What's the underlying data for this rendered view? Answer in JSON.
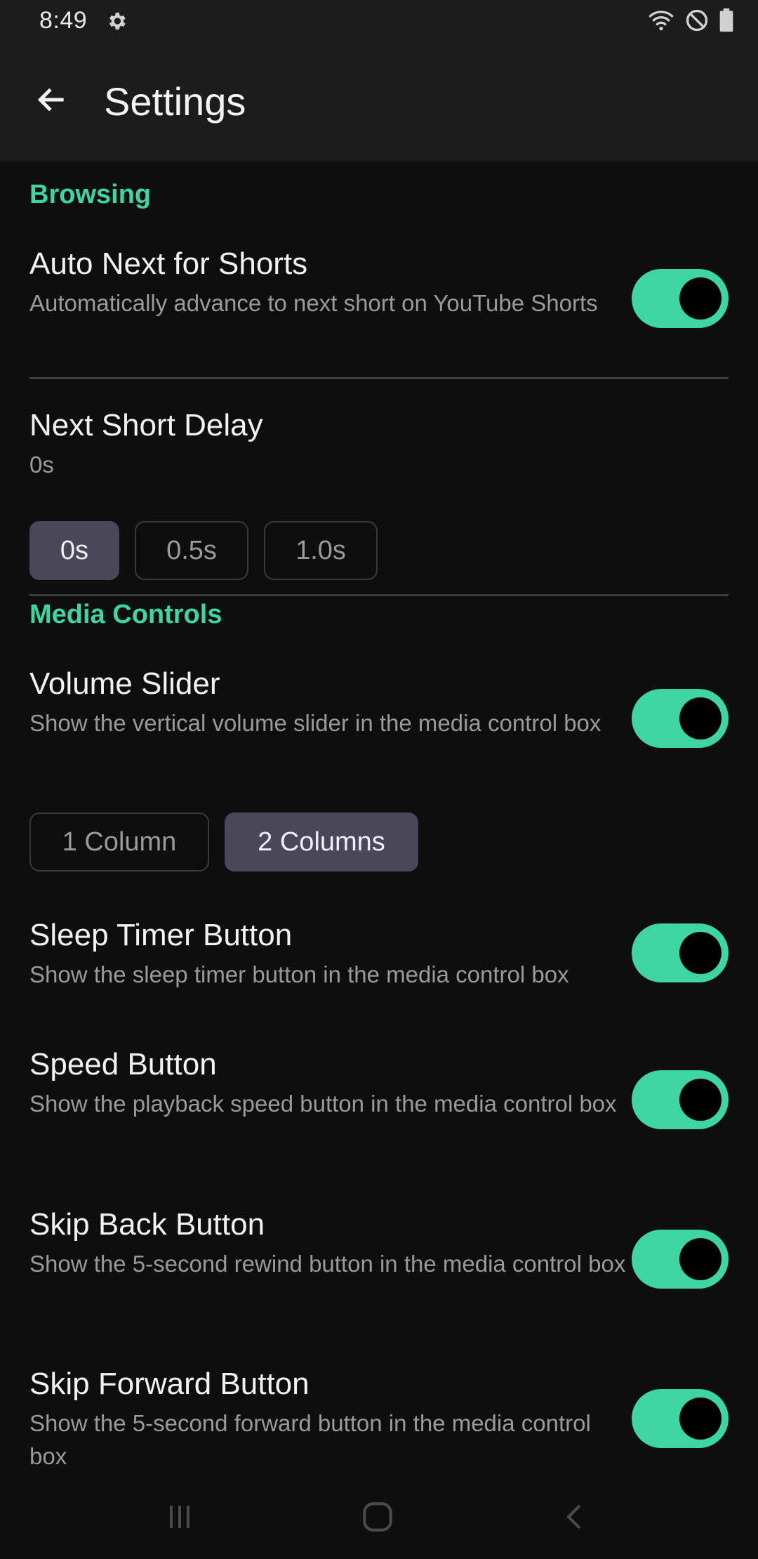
{
  "status_bar": {
    "time": "8:49",
    "icons": [
      "gear-icon",
      "wifi-icon",
      "do-not-disturb-icon",
      "battery-icon"
    ]
  },
  "app_bar": {
    "title": "Settings",
    "back_icon": "arrow-left-icon"
  },
  "colors": {
    "accent": "#3dd6a2",
    "chip_selected": "#4a4759",
    "background": "#0e0e0e",
    "app_bar": "#1c1c1c"
  },
  "sections": {
    "browsing": {
      "header": "Browsing",
      "auto_next": {
        "title": "Auto Next for Shorts",
        "desc": "Automatically advance to next short on YouTube Shorts",
        "enabled": true
      },
      "next_short_delay": {
        "title": "Next Short Delay",
        "value": "0s",
        "options": [
          "0s",
          "0.5s",
          "1.0s"
        ],
        "selected": "0s"
      }
    },
    "media_controls": {
      "header": "Media Controls",
      "volume_slider": {
        "title": "Volume Slider",
        "desc": "Show the vertical volume slider in the media control box",
        "enabled": true,
        "column_options": [
          "1 Column",
          "2 Columns"
        ],
        "selected_columns": "2 Columns"
      },
      "sleep_timer": {
        "title": "Sleep Timer Button",
        "desc": "Show the sleep timer button in the media control box",
        "enabled": true
      },
      "speed": {
        "title": "Speed Button",
        "desc": "Show the playback speed button in the media control box",
        "enabled": true
      },
      "skip_back": {
        "title": "Skip Back Button",
        "desc": "Show the 5-second rewind button in the media control box",
        "enabled": true
      },
      "skip_forward": {
        "title": "Skip Forward Button",
        "desc": "Show the 5-second forward button in the media control box",
        "enabled": true
      }
    }
  },
  "nav_bar": {
    "icons": [
      "recent-apps-icon",
      "home-icon",
      "back-icon"
    ]
  }
}
